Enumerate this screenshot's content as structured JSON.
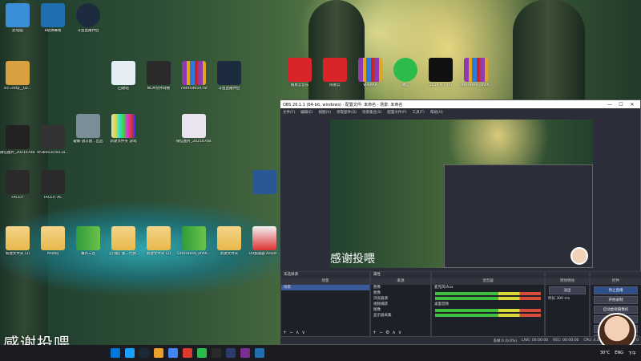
{
  "desktop": {
    "icons": [
      {
        "label": "此电脑"
      },
      {
        "label": "B站弹幕姬"
      },
      {
        "label": "斗鱼直播伴侣"
      },
      {
        "label": "src=http__02..."
      },
      {
        "label": "回收站"
      },
      {
        "label": "NCM文件转换"
      },
      {
        "label": "794959659.rar"
      },
      {
        "label": "斗鱼直播伴侣"
      },
      {
        "label": "微信图片_20210708..."
      },
      {
        "label": "6f3b0e3cc811a..."
      },
      {
        "label": "破解·放次建...出品"
      },
      {
        "label": "新建文件夹 游戏"
      },
      {
        "label": "微信图片_20210708..."
      },
      {
        "label": "FACEIT"
      },
      {
        "label": "FACEIT AC"
      },
      {
        "label": "新建文件夹 (3)"
      },
      {
        "label": "PR转码"
      },
      {
        "label": "番外三连"
      },
      {
        "label": "【小猪】富二代感..."
      },
      {
        "label": "新建文件夹 (2)"
      },
      {
        "label": "OHHHHHH_ohhh..."
      },
      {
        "label": "新建文件夹"
      },
      {
        "label": "UU加速器 Assist..."
      },
      {
        "label": "网易云音乐"
      },
      {
        "label": "网易云"
      },
      {
        "label": "WinRAR"
      },
      {
        "label": "微信"
      },
      {
        "label": "2019.6.5 (1)"
      },
      {
        "label": "OHHHHHH_ohhh..."
      }
    ]
  },
  "obs": {
    "title": "OBS 26.1.1 (64-bit, windows) - 配置文件: 未命名 - 场景: 未命名",
    "menu": [
      "文件(F)",
      "编辑(E)",
      "视图(V)",
      "停靠部件(D)",
      "场景集合(S)",
      "配置文件(P)",
      "工具(T)",
      "帮助(H)"
    ],
    "window_controls": {
      "min": "—",
      "max": "☐",
      "close": "✕"
    },
    "preview_watermark": "感谢投喂",
    "docks": {
      "scenes": {
        "title": "未选择源",
        "header": "场景",
        "items": [
          "场景"
        ]
      },
      "sources": {
        "title": "属性",
        "header": "来源",
        "items": [
          "图像",
          "图像",
          "浏览器源",
          "视频捕获",
          "图像",
          "显示器采集"
        ]
      },
      "mixer": {
        "header": "混音器",
        "tracks": [
          {
            "name": "麦克风/Aux",
            "db": "0.0 dB"
          },
          {
            "name": "桌面音频",
            "db": "0.0 dB"
          }
        ]
      },
      "transitions": {
        "header": "转场特效",
        "type": "淡出",
        "duration_label": "时长",
        "duration": "300 ms"
      },
      "controls": {
        "header": "控件",
        "buttons": [
          "停止直播",
          "开始录制",
          "启动虚拟摄像机",
          "工作室模式",
          "设置",
          "退出"
        ]
      }
    },
    "status": {
      "live": "LIVE: 00:00:00",
      "rec": "REC: 00:00:00",
      "cpu": "CPU: 4.3%, 30.00 fps",
      "dropped": "丢帧 0 (0.0%)",
      "kbps": "kb/s: 0"
    }
  },
  "overlay": {
    "watermark": "感谢投喂"
  },
  "taskbar": {
    "weather": "30°C",
    "lang": "ENG",
    "time": "下午"
  }
}
